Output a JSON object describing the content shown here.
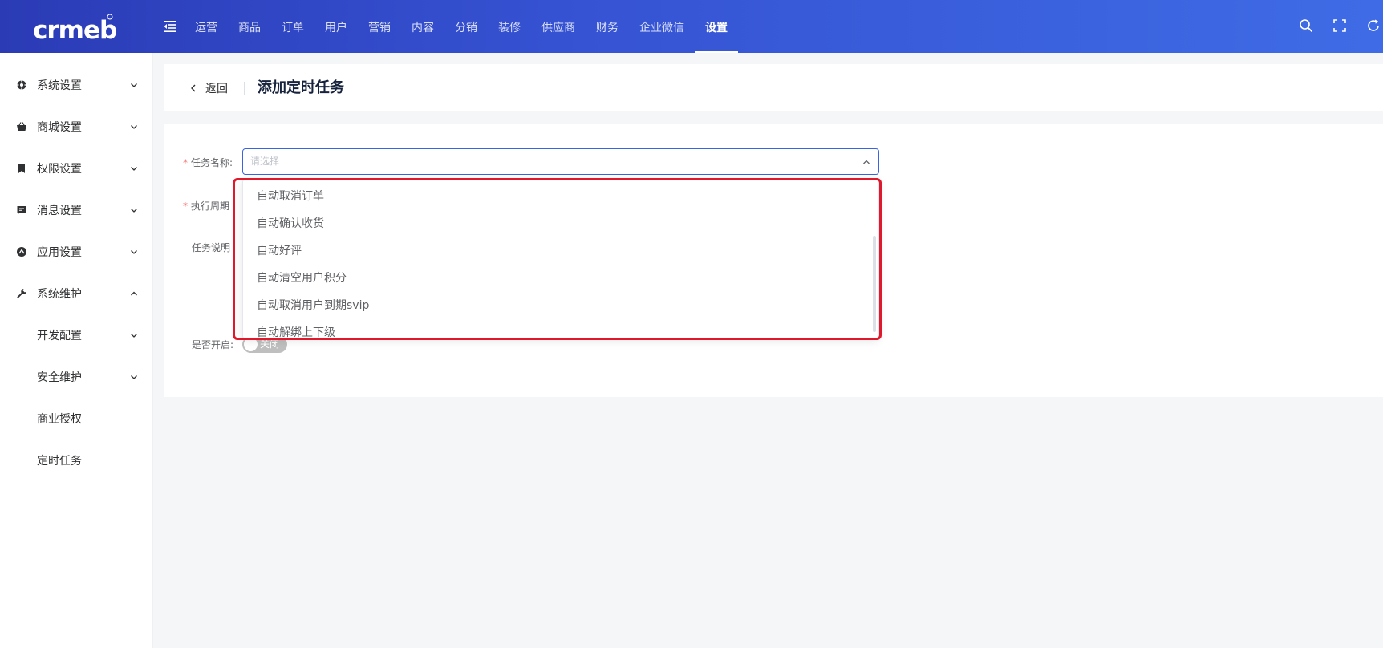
{
  "brand": {
    "logo_text": "crmeb"
  },
  "header": {
    "nav": [
      "运营",
      "商品",
      "订单",
      "用户",
      "营销",
      "内容",
      "分销",
      "装修",
      "供应商",
      "财务",
      "企业微信",
      "设置"
    ],
    "active_nav": "设置",
    "icons": [
      "search-icon",
      "fullscreen-icon",
      "refresh-icon"
    ]
  },
  "sidebar": {
    "items": [
      {
        "label": "系统设置",
        "icon": "gear-icon",
        "expanded": false
      },
      {
        "label": "商城设置",
        "icon": "basket-icon",
        "expanded": false
      },
      {
        "label": "权限设置",
        "icon": "bookmark-icon",
        "expanded": false
      },
      {
        "label": "消息设置",
        "icon": "message-icon",
        "expanded": false
      },
      {
        "label": "应用设置",
        "icon": "app-icon",
        "expanded": false
      },
      {
        "label": "系统维护",
        "icon": "wrench-icon",
        "expanded": true
      },
      {
        "label": "开发配置",
        "expanded": false
      },
      {
        "label": "安全维护",
        "expanded": false
      },
      {
        "label": "商业授权"
      },
      {
        "label": "定时任务"
      }
    ]
  },
  "page": {
    "back_label": "返回",
    "title": "添加定时任务"
  },
  "form": {
    "task_name_label": "任务名称:",
    "task_name_placeholder": "请选择",
    "cycle_label": "执行周期",
    "desc_label": "任务说明",
    "enabled_label": "是否开启:",
    "switch_off_text": "关闭"
  },
  "dropdown": {
    "options": [
      "自动取消订单",
      "自动确认收货",
      "自动好评",
      "自动清空用户积分",
      "自动取消用户到期svip",
      "自动解绑上下级"
    ]
  },
  "colors": {
    "header_start": "#2b3bb6",
    "header_end": "#3f6ce6",
    "primary": "#3a63e0",
    "highlight": "#e0182c",
    "required": "#f56c6c"
  }
}
